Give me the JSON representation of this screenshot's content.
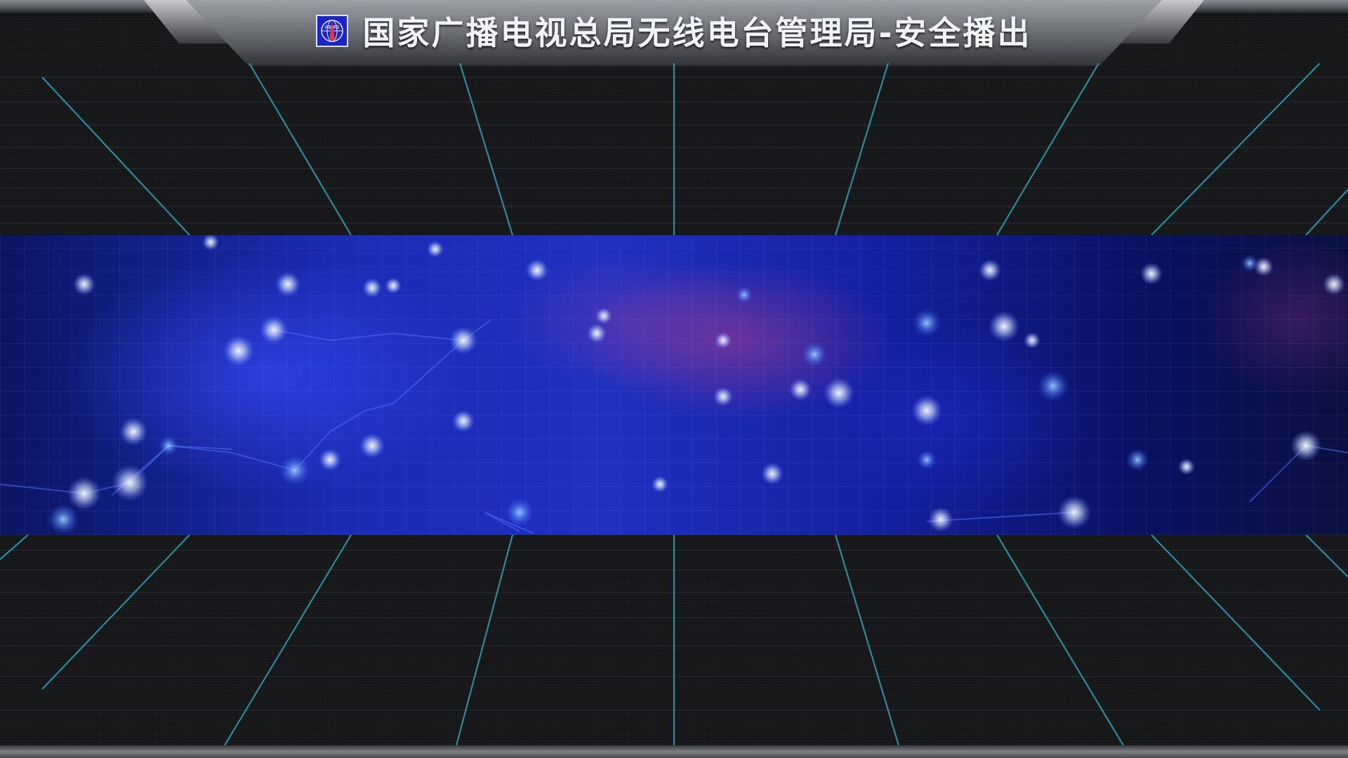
{
  "header": {
    "title": "国家广播电视总局无线电台管理局-安全播出",
    "logo_text": "AB·RS",
    "logo_icon": "abrs-logo-icon"
  },
  "colors": {
    "accent_grid_line": "#2fa0b8",
    "header_text": "#f2f3f5",
    "logo_background": "#1a24c8",
    "banner_blue": "#1b2bb4",
    "background": "#151618"
  }
}
